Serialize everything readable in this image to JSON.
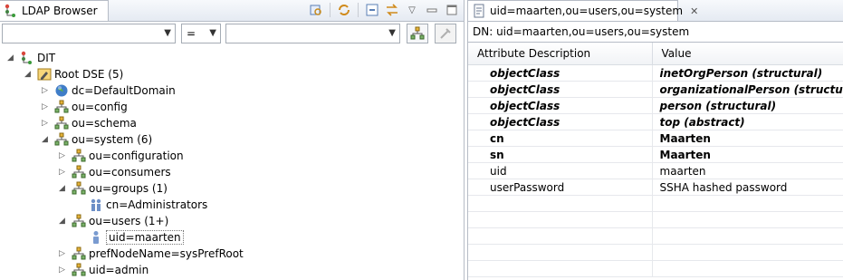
{
  "left_pane": {
    "title": "LDAP Browser",
    "filter": {
      "attribute_value": "",
      "operator_value": "=",
      "value_value": ""
    },
    "tree": [
      {
        "label": "DIT",
        "icon": "dit-icon",
        "level": 0,
        "twisty": "expanded"
      },
      {
        "label": "Root DSE (5)",
        "icon": "root-dse-icon",
        "level": 1,
        "twisty": "expanded"
      },
      {
        "label": "dc=DefaultDomain",
        "icon": "globe-icon",
        "level": 2,
        "twisty": "collapsed"
      },
      {
        "label": "ou=config",
        "icon": "org-unit-icon",
        "level": 2,
        "twisty": "collapsed"
      },
      {
        "label": "ou=schema",
        "icon": "org-unit-icon",
        "level": 2,
        "twisty": "collapsed"
      },
      {
        "label": "ou=system (6)",
        "icon": "org-unit-icon",
        "level": 2,
        "twisty": "expanded"
      },
      {
        "label": "ou=configuration",
        "icon": "org-unit-icon",
        "level": 3,
        "twisty": "collapsed"
      },
      {
        "label": "ou=consumers",
        "icon": "org-unit-icon",
        "level": 3,
        "twisty": "collapsed"
      },
      {
        "label": "ou=groups (1)",
        "icon": "org-unit-icon",
        "level": 3,
        "twisty": "expanded"
      },
      {
        "label": "cn=Administrators",
        "icon": "group-icon",
        "level": 4,
        "twisty": "none"
      },
      {
        "label": "ou=users (1+)",
        "icon": "org-unit-icon",
        "level": 3,
        "twisty": "expanded"
      },
      {
        "label": "uid=maarten",
        "icon": "person-icon",
        "level": 4,
        "twisty": "none",
        "selected": true
      },
      {
        "label": "prefNodeName=sysPrefRoot",
        "icon": "org-unit-icon",
        "level": 3,
        "twisty": "collapsed"
      },
      {
        "label": "uid=admin",
        "icon": "org-unit-icon",
        "level": 3,
        "twisty": "collapsed"
      }
    ]
  },
  "right_pane": {
    "tab_title": "uid=maarten,ou=users,ou=system",
    "dn_text": "DN: uid=maarten,ou=users,ou=system",
    "columns": [
      "Attribute Description",
      "Value"
    ],
    "rows": [
      {
        "attr": "objectClass",
        "value": "inetOrgPerson (structural)",
        "style": "oc"
      },
      {
        "attr": "objectClass",
        "value": "organizationalPerson (structural)",
        "style": "oc"
      },
      {
        "attr": "objectClass",
        "value": "person (structural)",
        "style": "oc"
      },
      {
        "attr": "objectClass",
        "value": "top (abstract)",
        "style": "oc"
      },
      {
        "attr": "cn",
        "value": "Maarten",
        "style": "must"
      },
      {
        "attr": "sn",
        "value": "Maarten",
        "style": "must"
      },
      {
        "attr": "uid",
        "value": "maarten",
        "style": "normal"
      },
      {
        "attr": "userPassword",
        "value": "SSHA hashed password",
        "style": "normal"
      },
      {
        "attr": "",
        "value": "",
        "style": "normal"
      },
      {
        "attr": "",
        "value": "",
        "style": "normal"
      },
      {
        "attr": "",
        "value": "",
        "style": "normal"
      },
      {
        "attr": "",
        "value": "",
        "style": "normal"
      },
      {
        "attr": "",
        "value": "",
        "style": "normal"
      }
    ]
  }
}
